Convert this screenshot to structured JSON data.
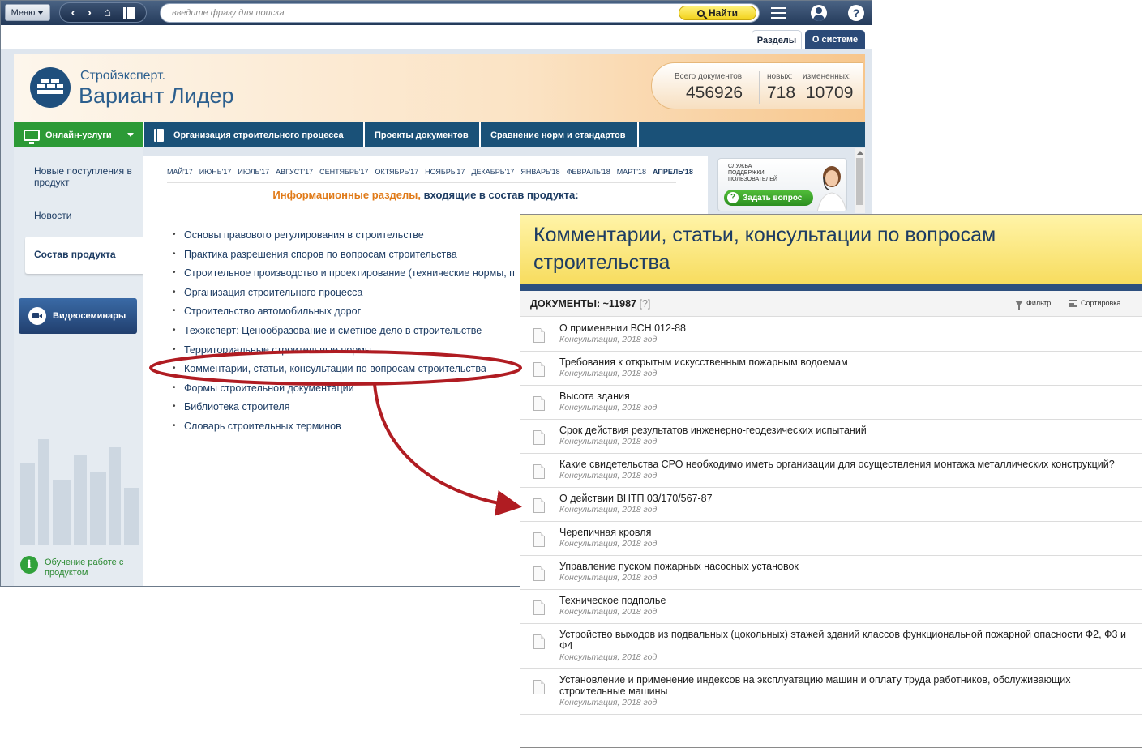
{
  "topbar": {
    "menu_label": "Меню",
    "search_placeholder": "введите фразу для поиска",
    "find_label": "Найти"
  },
  "tabs": [
    {
      "label": "Разделы"
    },
    {
      "label": "О системе"
    }
  ],
  "brand": {
    "small": "Стройэксперт.",
    "big": "Вариант Лидер"
  },
  "stats": {
    "total_label": "Всего документов:",
    "total_value": "456926",
    "new_label": "новых:",
    "new_value": "718",
    "changed_label": "измененных:",
    "changed_value": "10709"
  },
  "mainnav": {
    "online": "Онлайн-услуги",
    "items": [
      {
        "label": "Организация строительного процесса"
      },
      {
        "label": "Проекты документов"
      },
      {
        "label": "Сравнение норм и стандартов"
      }
    ]
  },
  "sidebar": {
    "new_arrivals": "Новые поступления в продукт",
    "news": "Новости",
    "composition": "Состав продукта",
    "video": "Видеосеминары",
    "learn": "Обучение работе с продуктом"
  },
  "months": [
    "МАЙ'17",
    "ИЮНЬ'17",
    "ИЮЛЬ'17",
    "АВГУСТ'17",
    "СЕНТЯБРЬ'17",
    "ОКТЯБРЬ'17",
    "НОЯБРЬ'17",
    "ДЕКАБРЬ'17",
    "ЯНВАРЬ'18",
    "ФЕВРАЛЬ'18",
    "МАРТ'18",
    "АПРЕЛЬ'18"
  ],
  "info_title": {
    "orange": "Информационные разделы,",
    "blue": " входящие в состав продукта:"
  },
  "sections": [
    "Основы правового регулирования в строительстве",
    "Практика разрешения споров по вопросам строительства",
    "Строительное производство и проектирование (технические нормы, п",
    "Организация строительного процесса",
    "Строительство автомобильных дорог",
    "Техэксперт: Ценообразование и сметное дело в строительстве",
    "Территориальные строительные нормы",
    "Комментарии, статьи, консультации по вопросам строительства",
    "Формы строительной документации",
    "Библиотека строителя",
    "Словарь строительных терминов"
  ],
  "support": {
    "text": "Служба поддержки пользователей",
    "ask": "Задать вопрос"
  },
  "popup": {
    "title": "Комментарии, статьи, консультации по вопросам строительства",
    "docs_label": "ДОКУМЕНТЫ: ~11987",
    "help": "[?]",
    "filter": "Фильтр",
    "sort": "Сортировка",
    "documents": [
      {
        "title": "О применении ВСН 012-88",
        "meta": "Консультация, 2018 год"
      },
      {
        "title": "Требования к открытым искусственным пожарным водоемам",
        "meta": "Консультация, 2018 год"
      },
      {
        "title": "Высота здания",
        "meta": "Консультация, 2018 год"
      },
      {
        "title": "Срок действия результатов инженерно-геодезических испытаний",
        "meta": "Консультация, 2018 год"
      },
      {
        "title": "Какие свидетельства СРО необходимо иметь организации для осуществления монтажа металлических конструкций?",
        "meta": "Консультация, 2018 год"
      },
      {
        "title": "О действии ВНТП 03/170/567-87",
        "meta": "Консультация, 2018 год"
      },
      {
        "title": "Черепичная кровля",
        "meta": "Консультация, 2018 год"
      },
      {
        "title": "Управление пуском пожарных насосных установок",
        "meta": "Консультация, 2018 год"
      },
      {
        "title": "Техническое подполье",
        "meta": "Консультация, 2018 год"
      },
      {
        "title": "Устройство выходов из подвальных (цокольных) этажей зданий классов функциональной пожарной опасности Ф2, Ф3 и Ф4",
        "meta": "Консультация, 2018 год"
      },
      {
        "title": "Установление и применение индексов на эксплуатацию машин и оплату труда работников, обслуживающих строительные машины",
        "meta": "Консультация, 2018 год"
      }
    ]
  },
  "colors": {
    "nav_blue": "#1a5178",
    "nav_green": "#2c9a36",
    "accent_orange": "#e07a18",
    "annotation_red": "#b01c22",
    "popup_yellow": "#f7dc5e"
  }
}
